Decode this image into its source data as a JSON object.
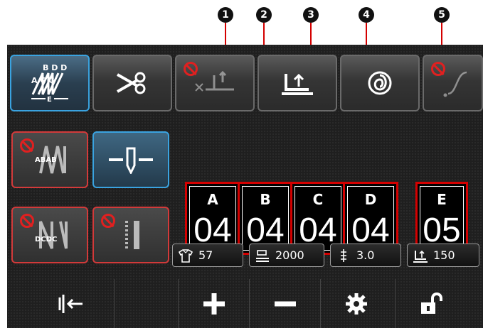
{
  "callouts": [
    "1",
    "2",
    "3",
    "4",
    "5"
  ],
  "values": [
    {
      "letter": "A",
      "value": "04"
    },
    {
      "letter": "B",
      "value": "04"
    },
    {
      "letter": "C",
      "value": "04"
    },
    {
      "letter": "D",
      "value": "04"
    },
    {
      "letter": "E",
      "value": "05"
    }
  ],
  "stats": {
    "pieces": "57",
    "speed": "2000",
    "pitch": "3.0",
    "lift": "150"
  },
  "icons": {
    "top": [
      "tack-pattern-icon",
      "scissors-icon",
      "thread-trim-presser-lift-icon",
      "presser-foot-lift-icon",
      "thread-wind-icon",
      "soft-start-icon"
    ],
    "bottom": [
      "needle-position-icon",
      "plus-icon",
      "minus-icon",
      "gear-icon",
      "unlock-icon"
    ]
  },
  "tack_labels": {
    "top": "B D D",
    "mid": "A C C",
    "bottom": "E",
    "abab": "ABAB",
    "dcdc": "DCDC"
  },
  "colors": {
    "accent": "#3aa3e0",
    "warning": "#d40000",
    "panel": "#1f1f1f"
  }
}
